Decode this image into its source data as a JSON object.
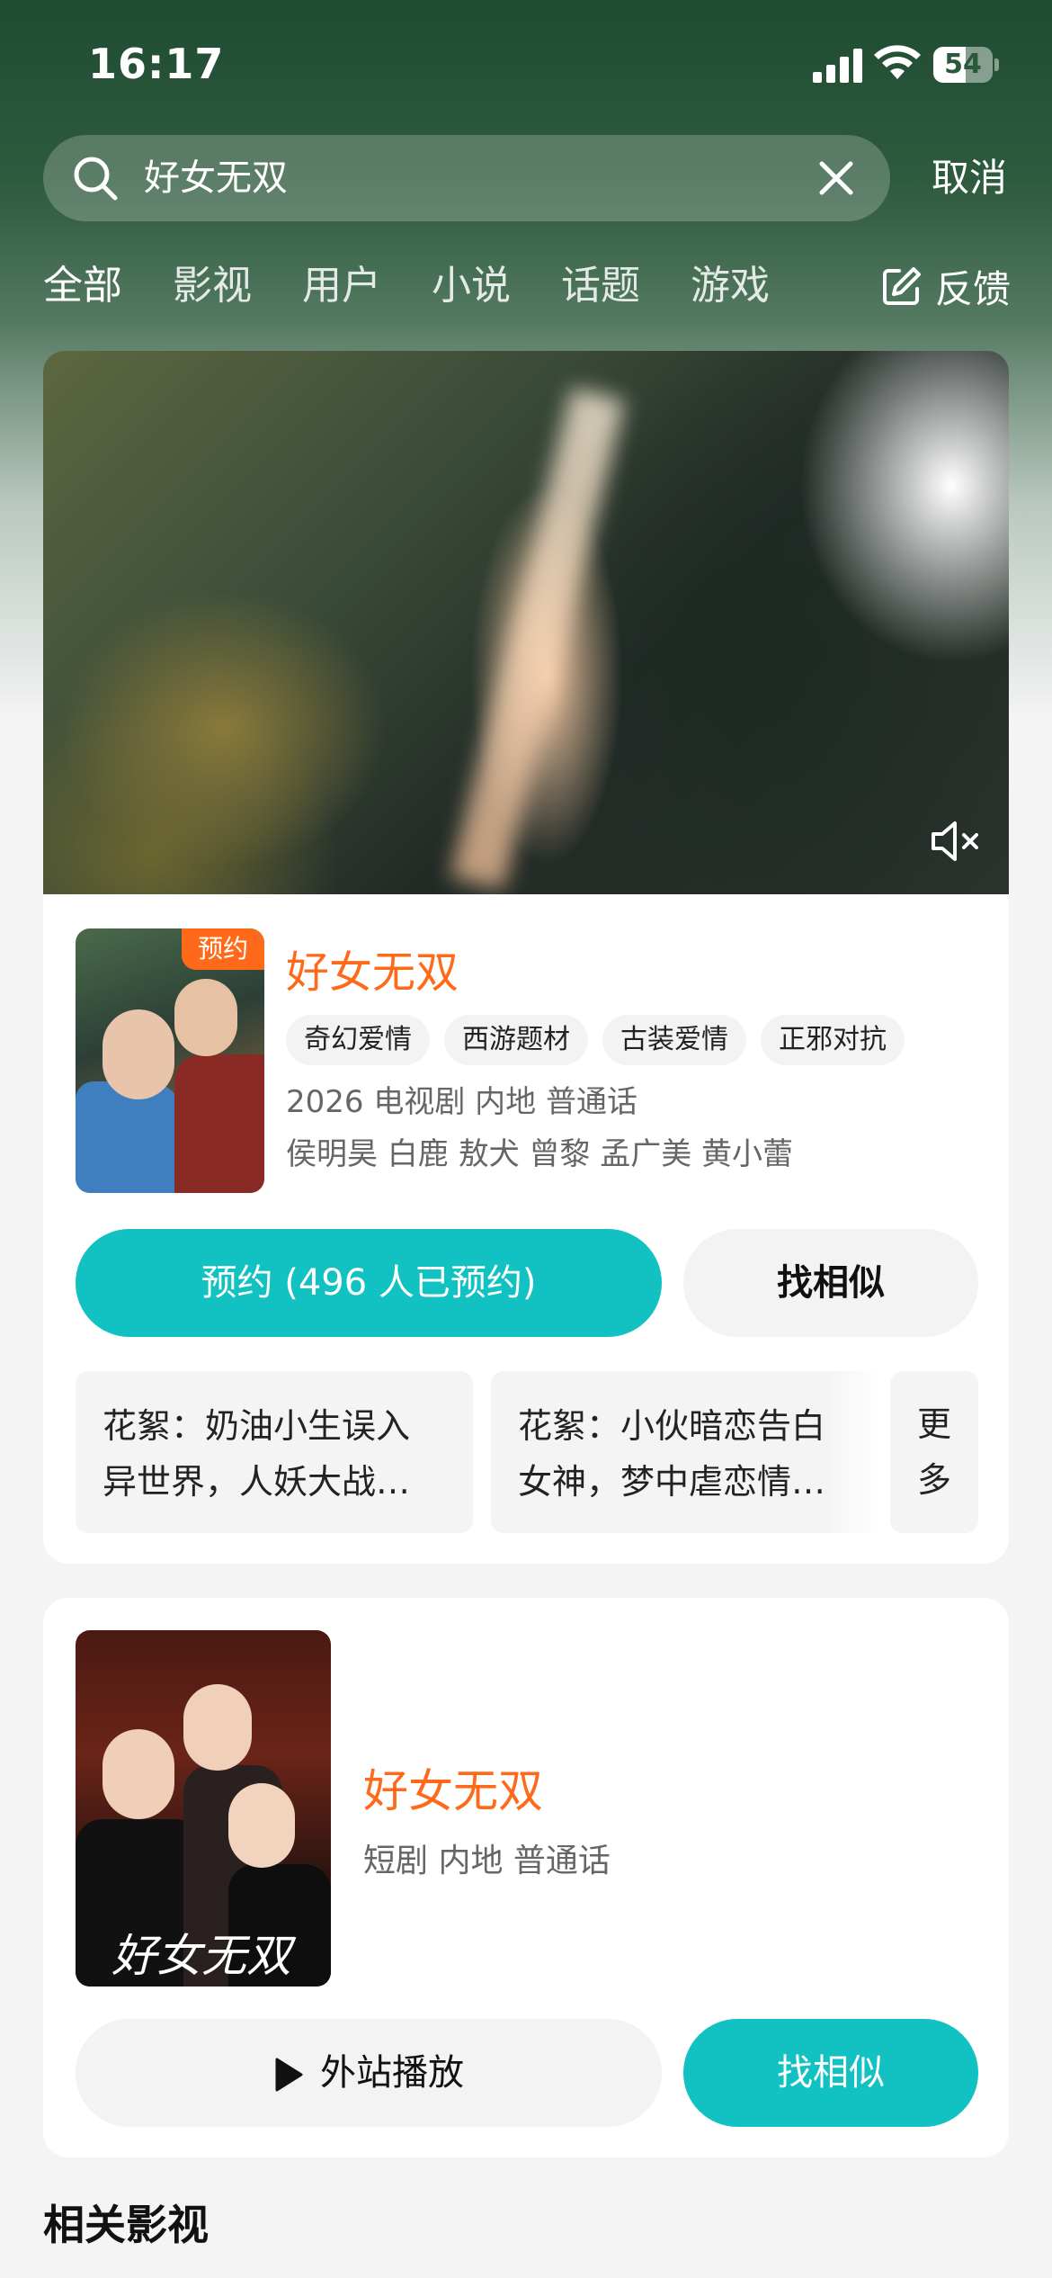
{
  "status_bar": {
    "time": "16:17",
    "battery_level": "54",
    "battery_fraction": 0.54
  },
  "search": {
    "query": "好女无双",
    "cancel_label": "取消"
  },
  "tabs": [
    "全部",
    "影视",
    "用户",
    "小说",
    "话题",
    "游戏"
  ],
  "feedback_label": "反馈",
  "video": {
    "mute_icon": "speaker-muted-icon"
  },
  "result1": {
    "badge": "预约",
    "title": "好女无双",
    "tags": [
      "奇幻爱情",
      "西游题材",
      "古装爱情",
      "正邪对抗"
    ],
    "meta": "2026 电视剧 内地 普通话",
    "cast": "侯明昊 白鹿 敖犬 曾黎 孟广美 黄小蕾",
    "reserve_button": "预约 (496 人已预约)",
    "similar_button": "找相似",
    "clips": [
      {
        "line1": "花絮：奶油小生误入",
        "line2": "异世界，人妖大战…"
      },
      {
        "line1": "花絮：小伙暗恋告白",
        "line2": "女神，梦中虐恋情…"
      }
    ],
    "more_line1": "更",
    "more_line2": "多"
  },
  "result2": {
    "title": "好女无双",
    "meta": "短剧 内地 普通话",
    "poster_logo": "好女无双",
    "external_button": "外站播放",
    "similar_button": "找相似"
  },
  "related_heading": "相关影视",
  "colors": {
    "accent": "#12c2c2",
    "title_orange": "#ff6a1a"
  }
}
